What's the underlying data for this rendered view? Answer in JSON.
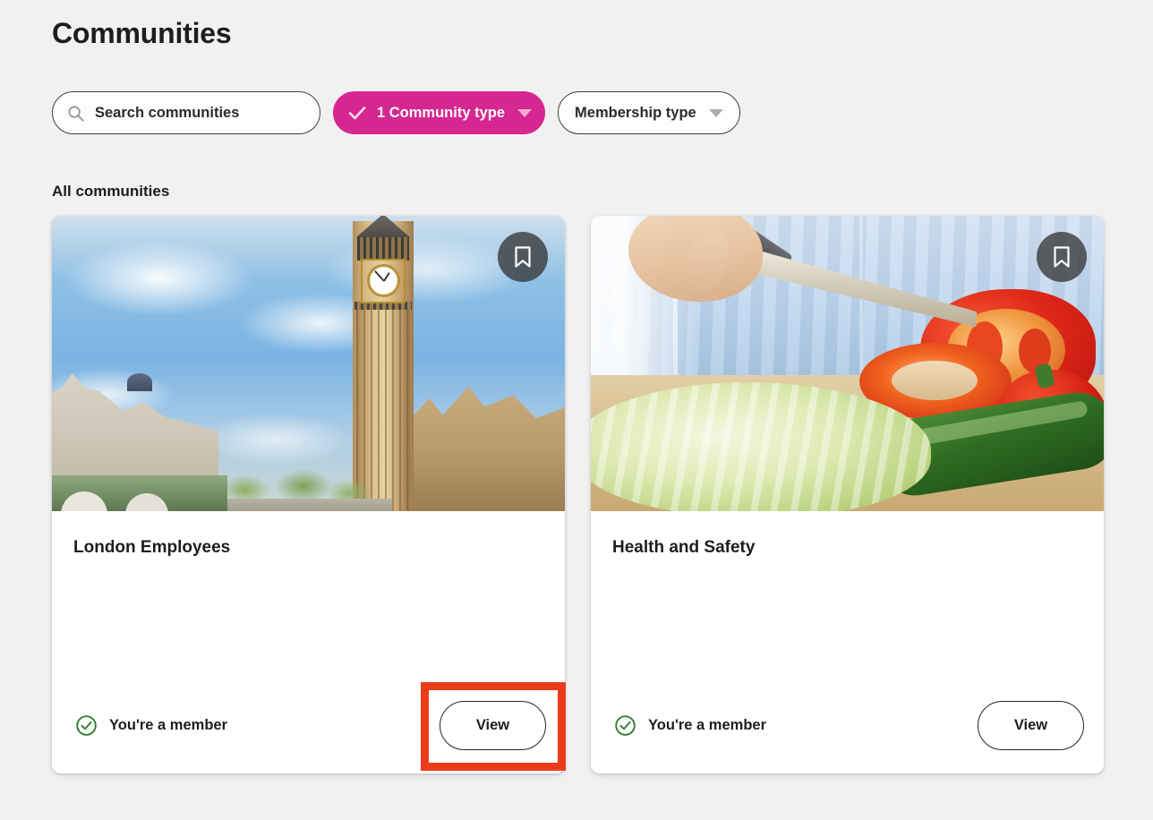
{
  "page": {
    "title": "Communities",
    "section_label": "All communities",
    "background_color": "#f1f1f1"
  },
  "search": {
    "placeholder": "Search communities",
    "icon": "search-icon"
  },
  "filters": [
    {
      "id": "community-type",
      "label": "1 Community type",
      "active": true,
      "check_icon": "check-icon",
      "caret_icon": "chevron-down-icon",
      "accent_color": "#d6268f",
      "text_color": "#ffffff"
    },
    {
      "id": "membership-type",
      "label": "Membership type",
      "active": false,
      "caret_icon": "chevron-down-icon",
      "accent_color": "#ffffff",
      "text_color": "#2b2b2b"
    }
  ],
  "cards": [
    {
      "id": "london-employees",
      "title": "London Employees",
      "image_alt": "Big Ben clock tower and Houses of Parliament under a blue cloudy sky",
      "bookmark_icon": "bookmark-icon",
      "membership_icon": "check-circle-icon",
      "membership_text": "You're a member",
      "membership_color": "#2f7d32",
      "action_label": "View",
      "highlighted": true
    },
    {
      "id": "health-and-safety",
      "title": "Health and Safety",
      "image_alt": "Person in a light blue shirt slicing a red bell pepper on a wooden board with lettuce and cucumber",
      "bookmark_icon": "bookmark-icon",
      "membership_icon": "check-circle-icon",
      "membership_text": "You're a member",
      "membership_color": "#2f7d32",
      "action_label": "View",
      "highlighted": false
    }
  ],
  "annotation": {
    "type": "highlight-box",
    "color": "#ea3c1b",
    "targets": "london-employees view button"
  }
}
